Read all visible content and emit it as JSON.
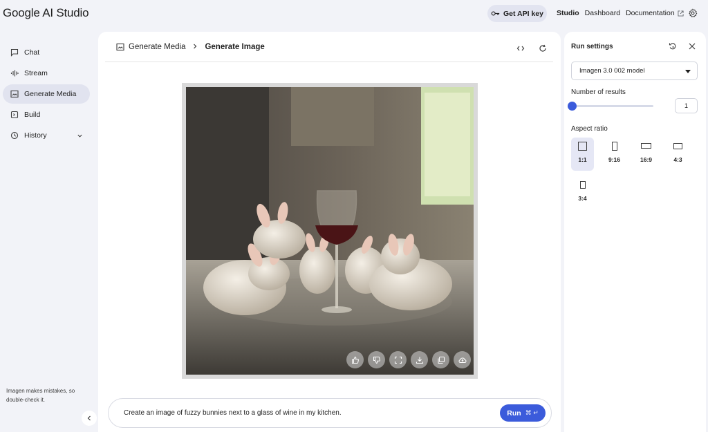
{
  "app": {
    "logo": "Google AI Studio"
  },
  "topbar": {
    "api_key_label": "Get API key",
    "nav": {
      "studio": "Studio",
      "dashboard": "Dashboard",
      "documentation": "Documentation"
    }
  },
  "sidebar": {
    "items": [
      {
        "label": "Chat",
        "icon": "chat-icon"
      },
      {
        "label": "Stream",
        "icon": "stream-icon"
      },
      {
        "label": "Generate Media",
        "icon": "media-icon",
        "active": true
      },
      {
        "label": "Build",
        "icon": "build-icon"
      },
      {
        "label": "History",
        "icon": "history-icon"
      }
    ],
    "disclaimer": "Imagen makes mistakes, so double-check it."
  },
  "main": {
    "breadcrumb": {
      "parent": "Generate Media",
      "current": "Generate Image"
    },
    "prompt": "Create an image of fuzzy bunnies next to a glass of wine in my kitchen.",
    "run_label": "Run",
    "run_shortcut": "⌘ ↵"
  },
  "run_settings": {
    "title": "Run settings",
    "model": "Imagen 3.0 002 model",
    "results_label": "Number of results",
    "results_value": "1",
    "slider_fraction": 0,
    "aspect_label": "Aspect ratio",
    "aspect_ratios": [
      "1:1",
      "9:16",
      "16:9",
      "4:3",
      "3:4"
    ],
    "selected_ratio": "1:1"
  },
  "colors": {
    "accent": "#3b5bdb",
    "selected_bg": "#e1e3ef",
    "page_bg": "#f2f3f8"
  }
}
